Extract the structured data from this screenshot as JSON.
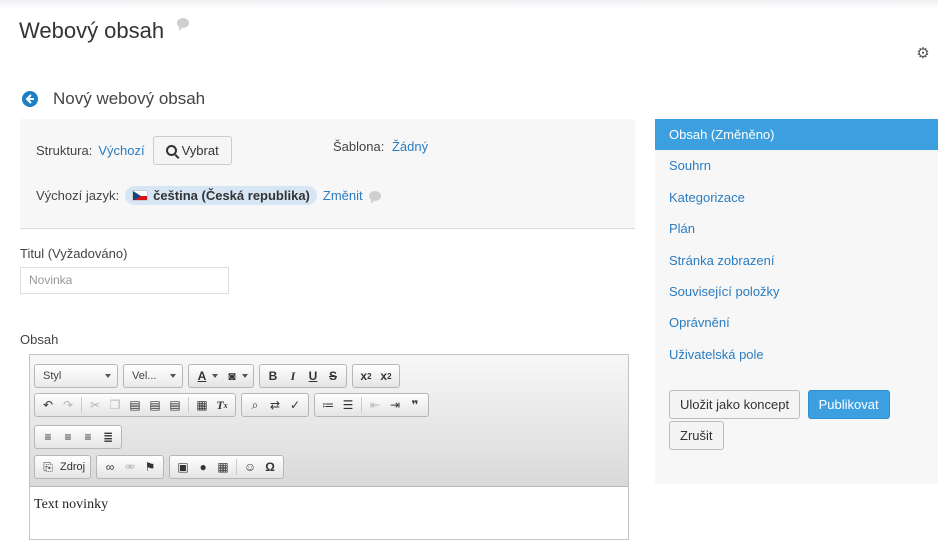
{
  "header": {
    "title": "Webový obsah",
    "back_title": "Nový webový obsah"
  },
  "structure": {
    "label": "Struktura:",
    "value": "Výchozí",
    "select_label": "Vybrat",
    "template_label": "Šablona:",
    "template_value": "Žádný"
  },
  "language": {
    "label": "Výchozí jazyk:",
    "value": "čeština (Česká republika)",
    "change_label": "Změnit"
  },
  "title_field": {
    "label": "Titul (Vyžadováno)",
    "value": "Novinka"
  },
  "content_field": {
    "label": "Obsah",
    "text": "Text novinky"
  },
  "toolbar": {
    "style_combo": "Styl",
    "size_combo": "Vel...",
    "source_label": "Zdroj"
  },
  "sidebar": {
    "items": [
      {
        "label": "Obsah (Změněno)",
        "active": true
      },
      {
        "label": "Souhrn"
      },
      {
        "label": "Kategorizace"
      },
      {
        "label": "Plán"
      },
      {
        "label": "Stránka zobrazení"
      },
      {
        "label": "Související položky"
      },
      {
        "label": "Oprávnění"
      },
      {
        "label": "Uživatelská pole"
      }
    ],
    "save_draft_label": "Uložit jako koncept",
    "publish_label": "Publikovat",
    "cancel_label": "Zrušit"
  },
  "colors": {
    "accent": "#3c9fe0",
    "link": "#2b7cc0"
  }
}
